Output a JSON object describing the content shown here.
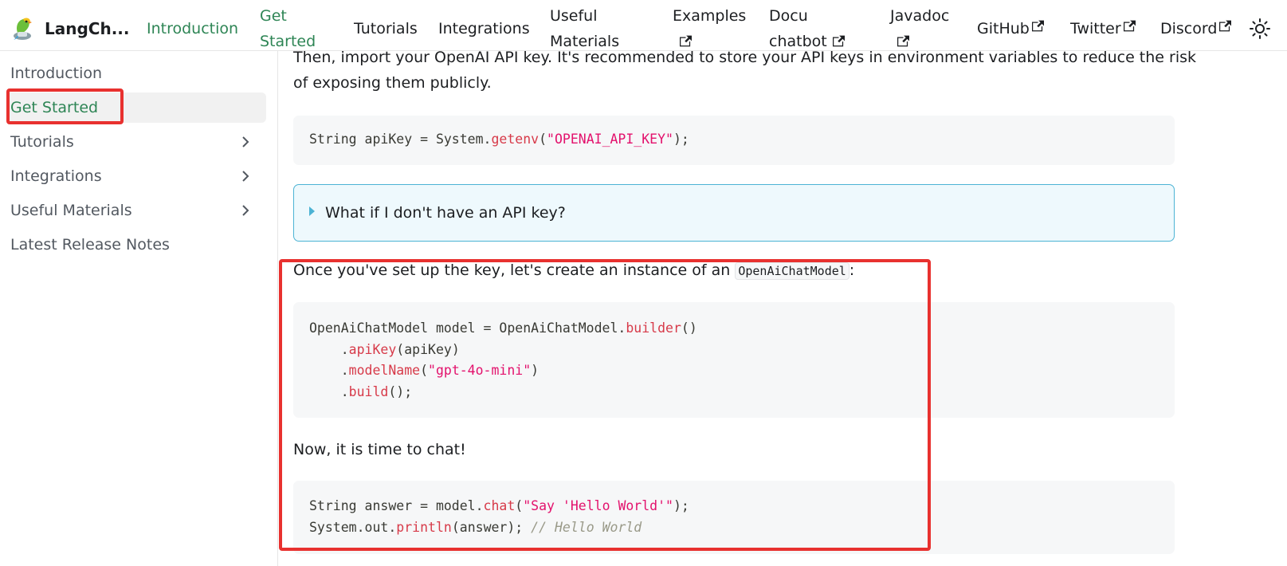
{
  "navbar": {
    "brand_title": "LangCh...",
    "items": [
      {
        "label": "Introduction",
        "active": true
      },
      {
        "label_line1": "Get",
        "label_line2": "Started"
      },
      {
        "label": "Tutorials"
      },
      {
        "label": "Integrations"
      },
      {
        "label_line1": "Useful",
        "label_line2": "Materials"
      },
      {
        "label_line1": "Examples",
        "external": true
      },
      {
        "label_line1": "Docu",
        "label_line2": "chatbot",
        "external": true
      },
      {
        "label_line1": "Javadoc",
        "external": true
      },
      {
        "label": "GitHub",
        "external": true
      },
      {
        "label": "Twitter",
        "external": true
      },
      {
        "label": "Discord",
        "external": true
      }
    ],
    "theme_icon": "sun-icon"
  },
  "sidebar": {
    "items": [
      {
        "label": "Introduction"
      },
      {
        "label": "Get Started",
        "active": true
      },
      {
        "label": "Tutorials",
        "expandable": true
      },
      {
        "label": "Integrations",
        "expandable": true
      },
      {
        "label": "Useful Materials",
        "expandable": true
      },
      {
        "label": "Latest Release Notes"
      }
    ]
  },
  "main": {
    "intro_line1": "Then, import your OpenAI API key. It's recommended to store your API keys in environment variables to reduce the risk",
    "intro_line2": "of exposing them publicly.",
    "code1": {
      "t1": "String apiKey = System.",
      "t2": "getenv",
      "t3": "(",
      "t4": "\"OPENAI_API_KEY\"",
      "t5": ");"
    },
    "details_summary": "What if I don't have an API key?",
    "model_para_before": "Once you've set up the key, let's create an instance of an ",
    "model_para_code": "OpenAiChatModel",
    "model_para_after": ":",
    "code2": {
      "l1a": "OpenAiChatModel model = OpenAiChatModel.",
      "l1b": "builder",
      "l1c": "()",
      "l2a": "    .",
      "l2b": "apiKey",
      "l2c": "(apiKey)",
      "l3a": "    .",
      "l3b": "modelName",
      "l3c": "(",
      "l3d": "\"gpt-4o-mini\"",
      "l3e": ")",
      "l4a": "    .",
      "l4b": "build",
      "l4c": "();"
    },
    "chat_para": "Now, it is time to chat!",
    "code3": {
      "l1a": "String answer = model.",
      "l1b": "chat",
      "l1c": "(",
      "l1d": "\"Say 'Hello World'\"",
      "l1e": ");",
      "l2a": "System.out.",
      "l2b": "println",
      "l2c": "(answer); ",
      "l2d": "// Hello World"
    }
  },
  "colors": {
    "accent": "#2e8555",
    "annotation": "#e8312f",
    "info_border": "#4cb3d4"
  }
}
